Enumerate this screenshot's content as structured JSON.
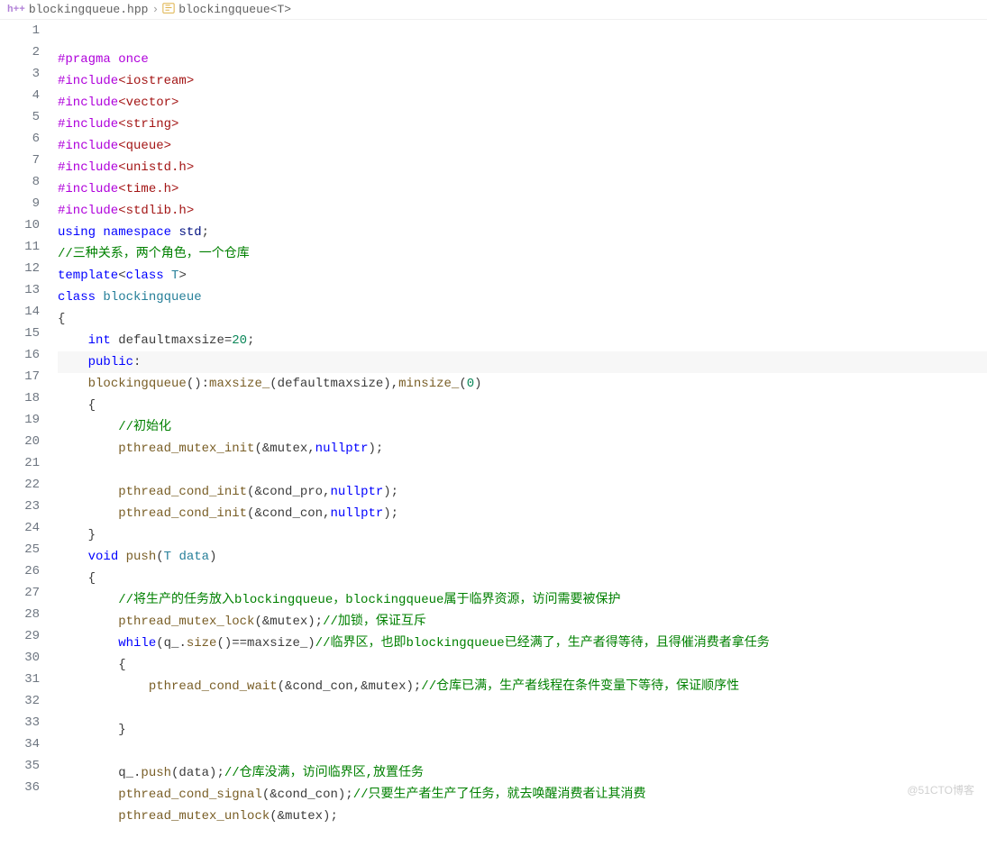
{
  "breadcrumb": {
    "file_icon": "h++",
    "file": "blockingqueue.hpp",
    "symbol": "blockingqueue<T>"
  },
  "watermark": "@51CTO博客",
  "first_line": 1,
  "lines": [
    [
      [
        "directive",
        "#pragma"
      ],
      [
        "plain",
        " "
      ],
      [
        "directive",
        "once"
      ]
    ],
    [
      [
        "directive",
        "#include"
      ],
      [
        "string",
        "<iostream>"
      ]
    ],
    [
      [
        "directive",
        "#include"
      ],
      [
        "string",
        "<vector>"
      ]
    ],
    [
      [
        "directive",
        "#include"
      ],
      [
        "string",
        "<string>"
      ]
    ],
    [
      [
        "directive",
        "#include"
      ],
      [
        "string",
        "<queue>"
      ]
    ],
    [
      [
        "directive",
        "#include"
      ],
      [
        "string",
        "<unistd.h>"
      ]
    ],
    [
      [
        "directive",
        "#include"
      ],
      [
        "string",
        "<time.h>"
      ]
    ],
    [
      [
        "directive",
        "#include"
      ],
      [
        "string",
        "<stdlib.h>"
      ]
    ],
    [
      [
        "keyword",
        "using"
      ],
      [
        "plain",
        " "
      ],
      [
        "keyword",
        "namespace"
      ],
      [
        "plain",
        " "
      ],
      [
        "ident",
        "std"
      ],
      [
        "plain",
        ";"
      ]
    ],
    [
      [
        "comment",
        "//三种关系，两个角色，一个仓库"
      ]
    ],
    [
      [
        "keyword",
        "template"
      ],
      [
        "plain",
        "<"
      ],
      [
        "keyword",
        "class"
      ],
      [
        "plain",
        " "
      ],
      [
        "type",
        "T"
      ],
      [
        "plain",
        ">"
      ]
    ],
    [
      [
        "keyword",
        "class"
      ],
      [
        "plain",
        " "
      ],
      [
        "class",
        "blockingqueue"
      ]
    ],
    [
      [
        "plain",
        "{"
      ]
    ],
    [
      [
        "plain",
        "    "
      ],
      [
        "keyword",
        "int"
      ],
      [
        "plain",
        " defaultmaxsize="
      ],
      [
        "number",
        "20"
      ],
      [
        "plain",
        ";"
      ]
    ],
    [
      [
        "plain",
        "    "
      ],
      [
        "keyword",
        "public"
      ],
      [
        "plain",
        ":"
      ]
    ],
    [
      [
        "plain",
        "    "
      ],
      [
        "func",
        "blockingqueue"
      ],
      [
        "plain",
        "():"
      ],
      [
        "func",
        "maxsize_"
      ],
      [
        "plain",
        "(defaultmaxsize),"
      ],
      [
        "func",
        "minsize_"
      ],
      [
        "plain",
        "("
      ],
      [
        "number",
        "0"
      ],
      [
        "plain",
        ")"
      ]
    ],
    [
      [
        "plain",
        "    {"
      ]
    ],
    [
      [
        "plain",
        "        "
      ],
      [
        "comment",
        "//初始化"
      ]
    ],
    [
      [
        "plain",
        "        "
      ],
      [
        "func",
        "pthread_mutex_init"
      ],
      [
        "plain",
        "(&mutex,"
      ],
      [
        "keyword",
        "nullptr"
      ],
      [
        "plain",
        ");"
      ]
    ],
    [
      [
        "plain",
        ""
      ]
    ],
    [
      [
        "plain",
        "        "
      ],
      [
        "func",
        "pthread_cond_init"
      ],
      [
        "plain",
        "(&cond_pro,"
      ],
      [
        "keyword",
        "nullptr"
      ],
      [
        "plain",
        ");"
      ]
    ],
    [
      [
        "plain",
        "        "
      ],
      [
        "func",
        "pthread_cond_init"
      ],
      [
        "plain",
        "(&cond_con,"
      ],
      [
        "keyword",
        "nullptr"
      ],
      [
        "plain",
        ");"
      ]
    ],
    [
      [
        "plain",
        "    }"
      ]
    ],
    [
      [
        "plain",
        "    "
      ],
      [
        "keyword",
        "void"
      ],
      [
        "plain",
        " "
      ],
      [
        "func",
        "push"
      ],
      [
        "plain",
        "("
      ],
      [
        "type",
        "T"
      ],
      [
        "plain",
        " "
      ],
      [
        "param",
        "data"
      ],
      [
        "plain",
        ")"
      ]
    ],
    [
      [
        "plain",
        "    {"
      ]
    ],
    [
      [
        "plain",
        "        "
      ],
      [
        "comment",
        "//将生产的任务放入blockingqueue，blockingqueue属于临界资源，访问需要被保护"
      ]
    ],
    [
      [
        "plain",
        "        "
      ],
      [
        "func",
        "pthread_mutex_lock"
      ],
      [
        "plain",
        "(&mutex);"
      ],
      [
        "comment",
        "//加锁，保证互斥"
      ]
    ],
    [
      [
        "plain",
        "        "
      ],
      [
        "keyword",
        "while"
      ],
      [
        "plain",
        "(q_."
      ],
      [
        "func",
        "size"
      ],
      [
        "plain",
        "()==maxsize_)"
      ],
      [
        "comment",
        "//临界区，也即blockingqueue已经满了，生产者得等待，且得催消费者拿任务"
      ]
    ],
    [
      [
        "plain",
        "        {"
      ]
    ],
    [
      [
        "plain",
        "            "
      ],
      [
        "func",
        "pthread_cond_wait"
      ],
      [
        "plain",
        "(&cond_con,&mutex);"
      ],
      [
        "comment",
        "//仓库已满，生产者线程在条件变量下等待，保证顺序性"
      ]
    ],
    [
      [
        "plain",
        ""
      ]
    ],
    [
      [
        "plain",
        "        }"
      ]
    ],
    [
      [
        "plain",
        ""
      ]
    ],
    [
      [
        "plain",
        "        q_."
      ],
      [
        "func",
        "push"
      ],
      [
        "plain",
        "(data);"
      ],
      [
        "comment",
        "//仓库没满，访问临界区,放置任务"
      ]
    ],
    [
      [
        "plain",
        "        "
      ],
      [
        "func",
        "pthread_cond_signal"
      ],
      [
        "plain",
        "(&cond_con);"
      ],
      [
        "comment",
        "//只要生产者生产了任务，就去唤醒消费者让其消费"
      ]
    ],
    [
      [
        "plain",
        "        "
      ],
      [
        "func",
        "pthread_mutex_unlock"
      ],
      [
        "plain",
        "(&mutex);"
      ]
    ]
  ],
  "highlight_index": 14
}
